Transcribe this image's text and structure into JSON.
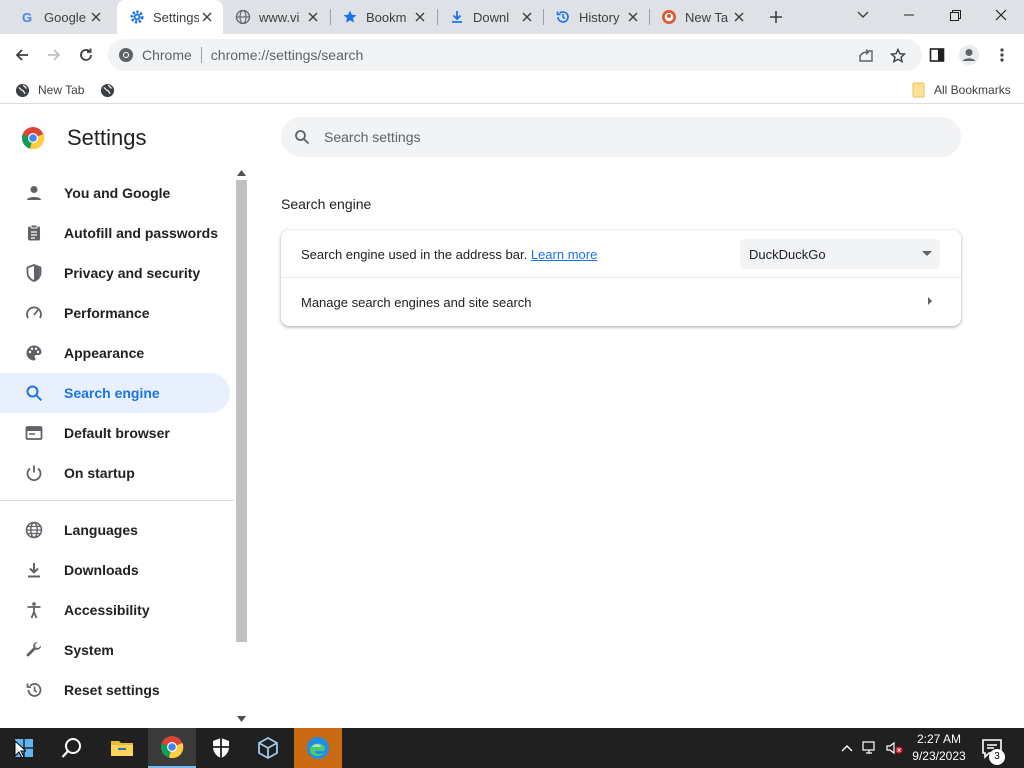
{
  "tabs": [
    {
      "title": "Google",
      "icon": "google-favicon"
    },
    {
      "title": "Settings",
      "icon": "gear-icon"
    },
    {
      "title": "www.vi",
      "icon": "globe-icon"
    },
    {
      "title": "Bookm",
      "icon": "star-icon"
    },
    {
      "title": "Downl",
      "icon": "download-icon"
    },
    {
      "title": "History",
      "icon": "history-icon"
    },
    {
      "title": "New Ta",
      "icon": "duckduckgo-icon"
    }
  ],
  "omnibox": {
    "chip": "Chrome",
    "url": "chrome://settings/search"
  },
  "bookmarks": {
    "new_tab": "New Tab",
    "all_bookmarks": "All Bookmarks"
  },
  "settings": {
    "title": "Settings",
    "search_placeholder": "Search settings"
  },
  "sidebar": {
    "items": [
      {
        "label": "You and Google",
        "icon": "person-icon"
      },
      {
        "label": "Autofill and passwords",
        "icon": "clipboard-icon"
      },
      {
        "label": "Privacy and security",
        "icon": "shield-icon"
      },
      {
        "label": "Performance",
        "icon": "gauge-icon"
      },
      {
        "label": "Appearance",
        "icon": "palette-icon"
      },
      {
        "label": "Search engine",
        "icon": "search-icon"
      },
      {
        "label": "Default browser",
        "icon": "browser-icon"
      },
      {
        "label": "On startup",
        "icon": "power-icon"
      },
      {
        "label": "Languages",
        "icon": "globe-icon"
      },
      {
        "label": "Downloads",
        "icon": "download-icon"
      },
      {
        "label": "Accessibility",
        "icon": "accessibility-icon"
      },
      {
        "label": "System",
        "icon": "wrench-icon"
      },
      {
        "label": "Reset settings",
        "icon": "reset-icon"
      }
    ],
    "selected": "Search engine"
  },
  "main": {
    "section_title": "Search engine",
    "row1_text": "Search engine used in the address bar.",
    "row1_link": "Learn more",
    "engine_value": "DuckDuckGo",
    "row2_text": "Manage search engines and site search"
  },
  "taskbar": {
    "time": "2:27 AM",
    "date": "9/23/2023",
    "notifications": "3"
  },
  "colors": {
    "accent": "#1a73e8",
    "selected_bg": "#e8f0fe",
    "taskbar": "#202020",
    "tab_strip": "#dee1e6"
  }
}
